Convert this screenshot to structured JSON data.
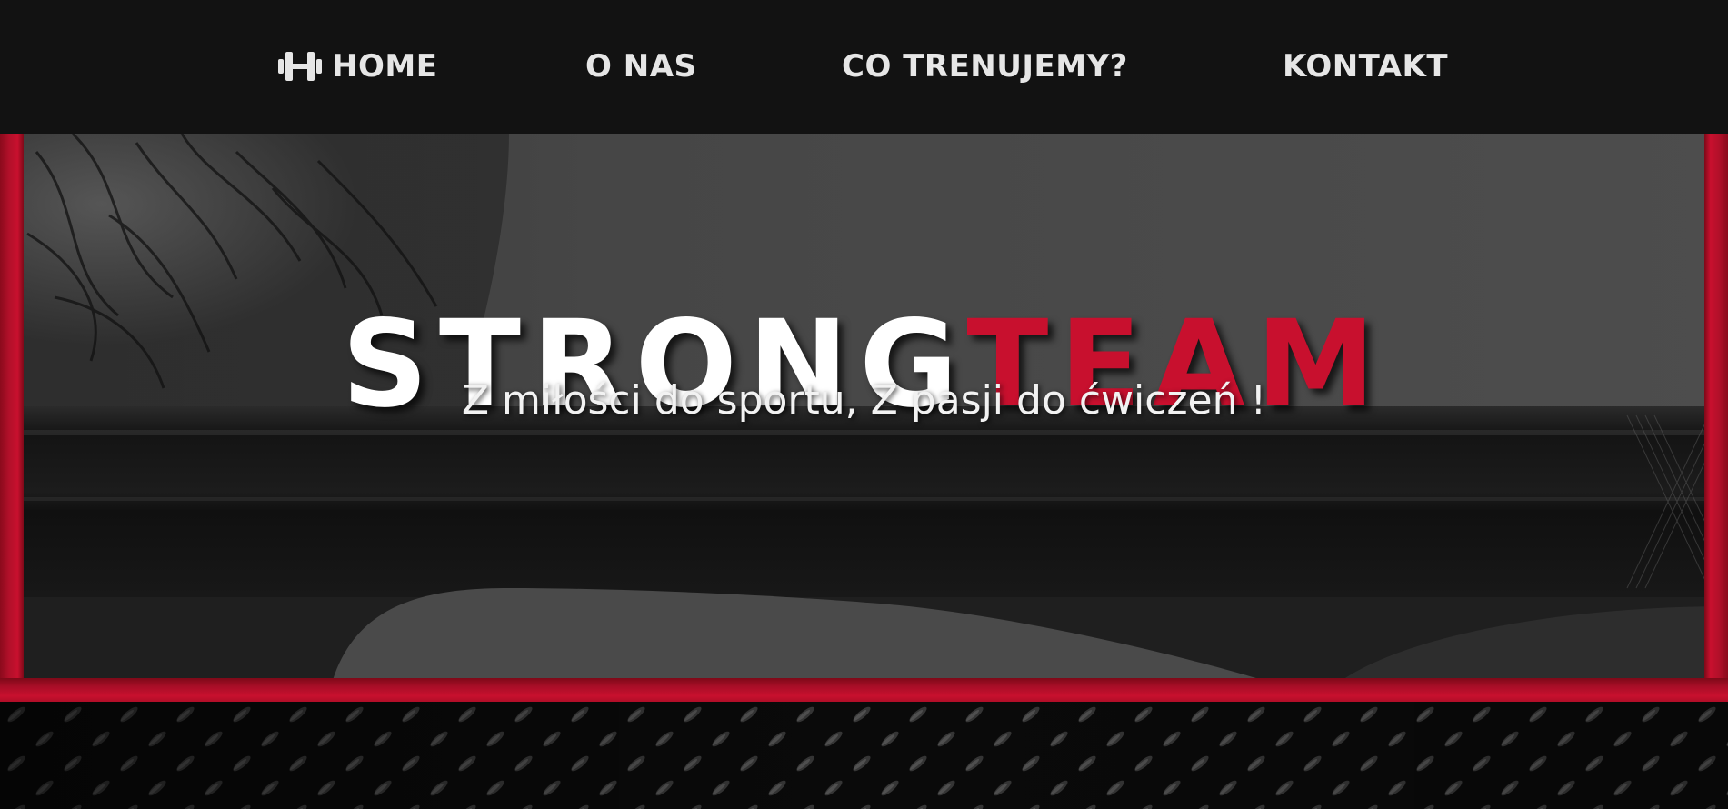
{
  "colors": {
    "accent": "#c8102e",
    "nav_bg": "#121212",
    "nav_text": "#e6e6e6",
    "hero_text": "#ffffff"
  },
  "nav": {
    "items": [
      {
        "label": "HOME",
        "icon": "dumbbell-icon"
      },
      {
        "label": "O NAS"
      },
      {
        "label": "CO TRENUJEMY?"
      },
      {
        "label": "KONTAKT"
      }
    ]
  },
  "hero": {
    "title_part1": "STRONG",
    "title_part2": "TEAM",
    "subtitle": "Z miłości do sportu, Z pasji do ćwiczeń !"
  }
}
